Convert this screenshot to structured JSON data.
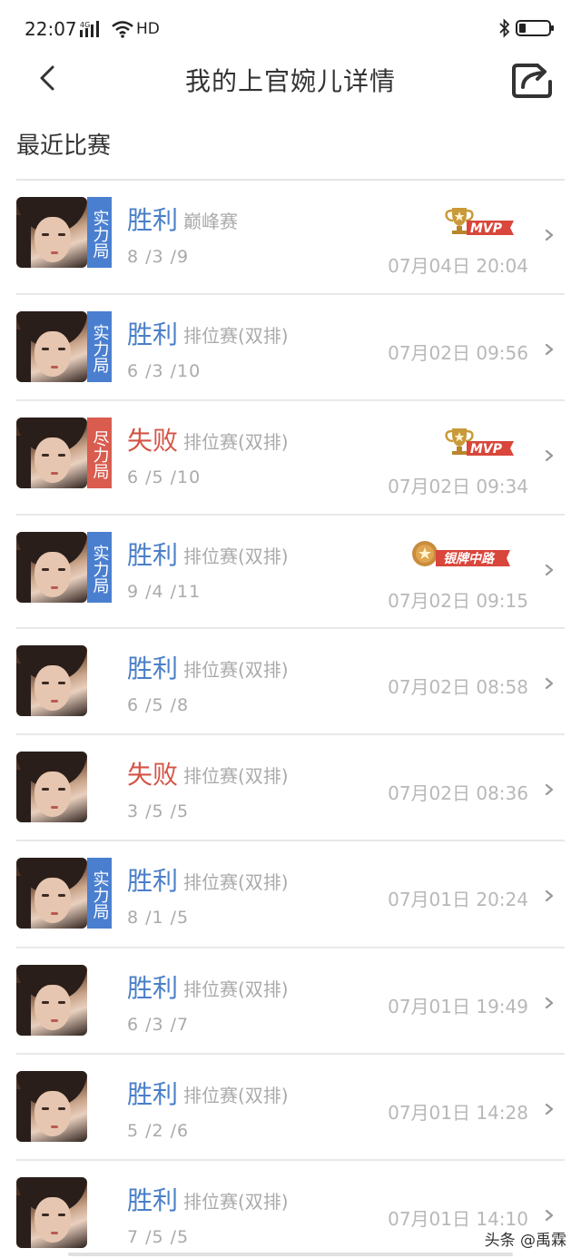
{
  "status": {
    "time": "22:07",
    "network": "4G",
    "hd": "HD"
  },
  "header": {
    "title": "我的上官婉儿详情"
  },
  "section": {
    "title": "最近比赛"
  },
  "badges": {
    "mvp": "MVP",
    "silver_mid": "银牌中路"
  },
  "colors": {
    "win": "#4a7fc9",
    "lose": "#d45446",
    "tag_blue": "#4a7fd0",
    "tag_red": "#d95c4f"
  },
  "matches": [
    {
      "result": "胜利",
      "result_type": "win",
      "mode": "巅峰赛",
      "kda": "8 /3 /9",
      "date": "07月04日 20:04",
      "tag": "实力局",
      "tag_color": "blue",
      "badge": "mvp"
    },
    {
      "result": "胜利",
      "result_type": "win",
      "mode": "排位赛(双排)",
      "kda": "6 /3 /10",
      "date": "07月02日 09:56",
      "tag": "实力局",
      "tag_color": "blue",
      "badge": ""
    },
    {
      "result": "失败",
      "result_type": "lose",
      "mode": "排位赛(双排)",
      "kda": "6 /5 /10",
      "date": "07月02日 09:34",
      "tag": "尽力局",
      "tag_color": "red",
      "badge": "mvp"
    },
    {
      "result": "胜利",
      "result_type": "win",
      "mode": "排位赛(双排)",
      "kda": "9 /4 /11",
      "date": "07月02日 09:15",
      "tag": "实力局",
      "tag_color": "blue",
      "badge": "silver"
    },
    {
      "result": "胜利",
      "result_type": "win",
      "mode": "排位赛(双排)",
      "kda": "6 /5 /8",
      "date": "07月02日 08:58",
      "tag": "",
      "tag_color": "",
      "badge": ""
    },
    {
      "result": "失败",
      "result_type": "lose",
      "mode": "排位赛(双排)",
      "kda": "3 /5 /5",
      "date": "07月02日 08:36",
      "tag": "",
      "tag_color": "",
      "badge": ""
    },
    {
      "result": "胜利",
      "result_type": "win",
      "mode": "排位赛(双排)",
      "kda": "8 /1 /5",
      "date": "07月01日 20:24",
      "tag": "实力局",
      "tag_color": "blue",
      "badge": ""
    },
    {
      "result": "胜利",
      "result_type": "win",
      "mode": "排位赛(双排)",
      "kda": "6 /3 /7",
      "date": "07月01日 19:49",
      "tag": "",
      "tag_color": "",
      "badge": ""
    },
    {
      "result": "胜利",
      "result_type": "win",
      "mode": "排位赛(双排)",
      "kda": "5 /2 /6",
      "date": "07月01日 14:28",
      "tag": "",
      "tag_color": "",
      "badge": ""
    },
    {
      "result": "胜利",
      "result_type": "win",
      "mode": "排位赛(双排)",
      "kda": "7 /5 /5",
      "date": "07月01日 14:10",
      "tag": "",
      "tag_color": "",
      "badge": ""
    }
  ],
  "watermark": "头条 @禹霖"
}
